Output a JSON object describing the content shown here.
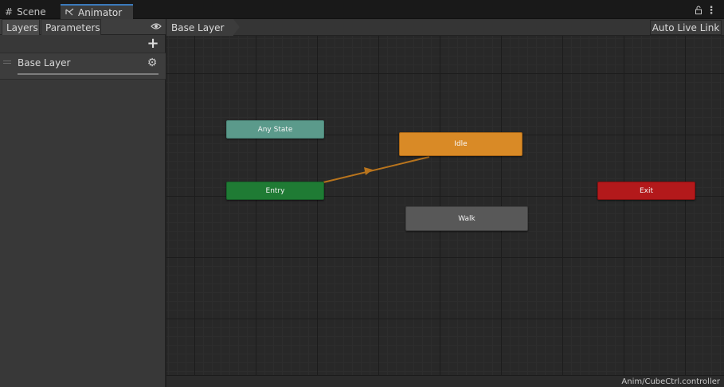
{
  "tabs": [
    {
      "label": "Scene",
      "icon": "grid-icon"
    },
    {
      "label": "Animator",
      "icon": "animator-icon"
    }
  ],
  "window_icons": [
    "lock-icon",
    "kebab-menu-icon"
  ],
  "left_panel": {
    "tabs": [
      "Layers",
      "Parameters"
    ],
    "layers": [
      {
        "name": "Base Layer"
      }
    ]
  },
  "toolbar": {
    "breadcrumb": "Base Layer",
    "live_link": "Auto Live Link"
  },
  "states": {
    "any_state": {
      "label": "Any State",
      "color": "#5b9a8b"
    },
    "idle": {
      "label": "Idle",
      "color": "#d98a26"
    },
    "entry": {
      "label": "Entry",
      "color": "#1f7b34"
    },
    "exit": {
      "label": "Exit",
      "color": "#b3191b"
    },
    "walk": {
      "label": "Walk",
      "color": "#585858"
    }
  },
  "transitions": [
    {
      "from": "Entry",
      "to": "Idle",
      "color": "#b8741d"
    }
  ],
  "status": {
    "asset_path": "Anim/CubeCtrl.controller"
  }
}
